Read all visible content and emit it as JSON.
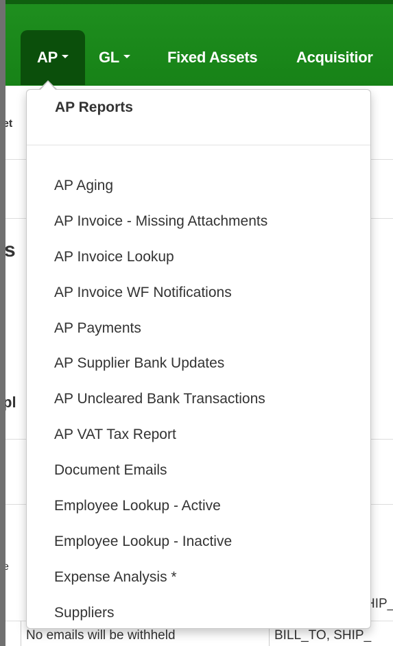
{
  "navbar": {
    "items": [
      {
        "label": "AP",
        "dropdown": true
      },
      {
        "label": "GL",
        "dropdown": true
      },
      {
        "label": "Fixed Assets",
        "dropdown": false
      },
      {
        "label": "Acquisitior",
        "dropdown": false
      }
    ],
    "color": "#1a861a",
    "active_color": "#0b4f0b"
  },
  "background": {
    "frag_1": "et",
    "frag_2": "s",
    "frag_3": "pl",
    "frag_4": "e",
    "footer_left": "No emails will be withheld",
    "footer_right": "BILL_TO, SHIP_",
    "frag_ship": "HIP_"
  },
  "dropdown": {
    "header": "AP Reports",
    "items": [
      "AP Aging",
      "AP Invoice - Missing Attachments",
      "AP Invoice Lookup",
      "AP Invoice WF Notifications",
      "AP Payments",
      "AP Supplier Bank Updates",
      "AP Uncleared Bank Transactions",
      "AP VAT Tax Report",
      "Document Emails",
      "Employee Lookup - Active",
      "Employee Lookup - Inactive",
      "Expense Analysis *",
      "Suppliers"
    ]
  }
}
